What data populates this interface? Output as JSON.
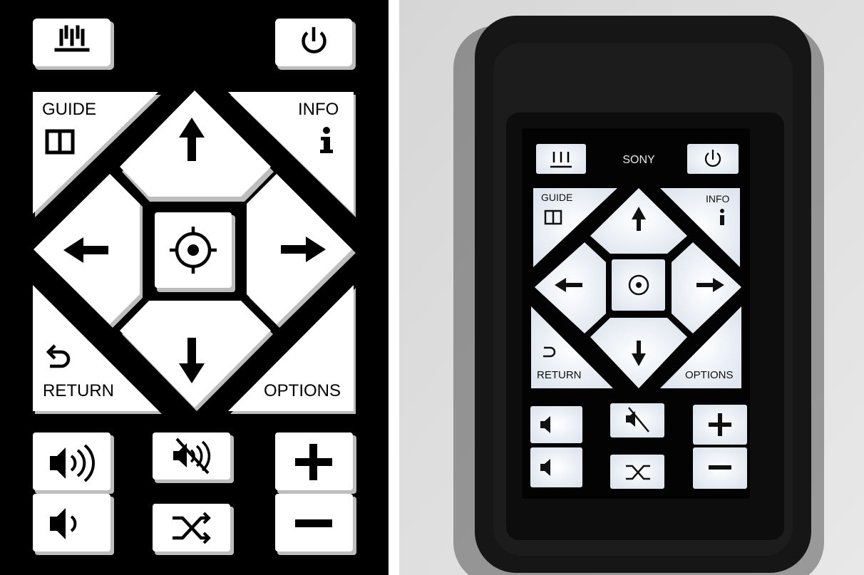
{
  "remote": {
    "buttons": {
      "input_icon": "input-source-icon",
      "power_icon": "power-icon",
      "guide": {
        "label": "GUIDE",
        "icon": "book-icon"
      },
      "info": {
        "label": "INFO",
        "icon": "info-icon"
      },
      "up_icon": "arrow-up-icon",
      "down_icon": "arrow-down-icon",
      "left_icon": "arrow-left-icon",
      "right_icon": "arrow-right-icon",
      "ok_icon": "target-icon",
      "return": {
        "label": "RETURN",
        "icon": "return-icon"
      },
      "options": {
        "label": "OPTIONS"
      },
      "volume_up_icon": "speaker-loud-icon",
      "volume_down_icon": "speaker-quiet-icon",
      "mute_icon": "speaker-muted-icon",
      "shuffle_icon": "shuffle-icon",
      "plus_icon": "plus-icon",
      "minus_icon": "minus-icon"
    }
  },
  "device_photo": {
    "brand_label": "SONY",
    "buttons": {
      "guide": "GUIDE",
      "info": "INFO",
      "return": "RETURN",
      "options": "OPTIONS"
    }
  },
  "colors": {
    "screen_bg": "#000000",
    "button_face": "#ffffff",
    "casing": "#161616",
    "photo_background": "#dcdcdc"
  }
}
